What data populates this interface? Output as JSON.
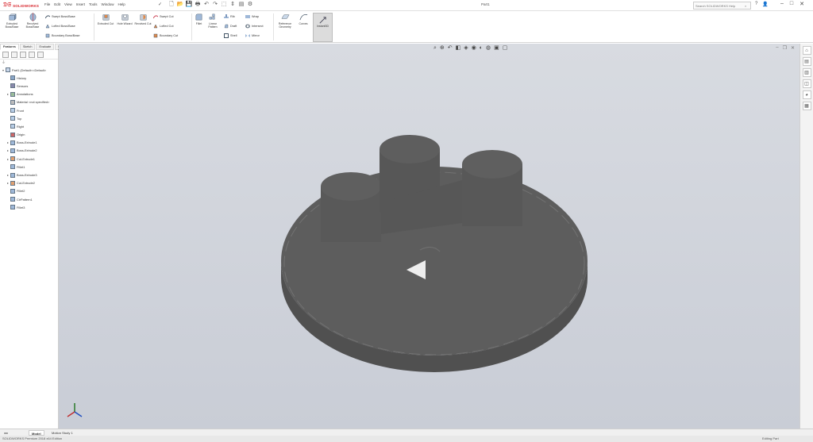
{
  "app": {
    "brand": "SOLIDWORKS",
    "doc_title": "Part1"
  },
  "menu": [
    "File",
    "Edit",
    "View",
    "Insert",
    "Tools",
    "Window",
    "Help"
  ],
  "quick_access_icons": [
    "new-doc-icon",
    "open-icon",
    "save-icon",
    "print-icon",
    "undo-icon",
    "redo-icon",
    "select-icon",
    "rebuild-icon",
    "file-props-icon",
    "options-icon"
  ],
  "search": {
    "placeholder": "Search SOLIDWORKS Help"
  },
  "ribbon": {
    "extruded_bossbase": "Extruded Boss/Base",
    "revolved_bossbase": "Revolved Boss/Base",
    "swept_bossbase": "Swept Boss/Base",
    "lofted_bossbase": "Lofted Boss/Base",
    "boundary_bossbase": "Boundary Boss/Base",
    "extruded_cut": "Extruded Cut",
    "hole_wizard": "Hole Wizard",
    "revolved_cut": "Revolved Cut",
    "swept_cut": "Swept Cut",
    "lofted_cut": "Lofted Cut",
    "boundary_cut": "Boundary Cut",
    "fillet": "Fillet",
    "linear_pattern": "Linear Pattern",
    "rib": "Rib",
    "draft": "Draft",
    "shell": "Shell",
    "wrap": "Wrap",
    "intersect": "Intersect",
    "mirror": "Mirror",
    "reference_geometry": "Reference Geometry",
    "curves": "Curves",
    "instant3d": "Instant3D"
  },
  "command_tabs": [
    "Features",
    "Sketch",
    "Evaluate",
    "MBD Dimensions"
  ],
  "feature_tree": {
    "root": "Part1 (Default<<Default>",
    "items": [
      {
        "label": "History",
        "icon": "history-icon",
        "level": 1
      },
      {
        "label": "Sensors",
        "icon": "sensor-icon",
        "level": 1
      },
      {
        "label": "Annotations",
        "icon": "annotation-icon",
        "level": 1,
        "expandable": true
      },
      {
        "label": "Material <not specified>",
        "icon": "material-icon",
        "level": 1
      },
      {
        "label": "Front",
        "icon": "plane-icon",
        "level": 1
      },
      {
        "label": "Top",
        "icon": "plane-icon",
        "level": 1
      },
      {
        "label": "Right",
        "icon": "plane-icon",
        "level": 1
      },
      {
        "label": "Origin",
        "icon": "origin-icon",
        "level": 1
      },
      {
        "label": "Boss-Extrude1",
        "icon": "extrude-icon",
        "level": 1,
        "expandable": true
      },
      {
        "label": "Boss-Extrude2",
        "icon": "extrude-icon",
        "level": 1,
        "expandable": true
      },
      {
        "label": "Cut-Extrude1",
        "icon": "cut-icon",
        "level": 1,
        "expandable": true
      },
      {
        "label": "Fillet1",
        "icon": "fillet-icon",
        "level": 1
      },
      {
        "label": "Boss-Extrude3",
        "icon": "extrude-icon",
        "level": 1,
        "expandable": true
      },
      {
        "label": "Cut-Extrude2",
        "icon": "cut-icon",
        "level": 1,
        "expandable": true
      },
      {
        "label": "Fillet2",
        "icon": "fillet-icon",
        "level": 1
      },
      {
        "label": "CirPattern1",
        "icon": "pattern-icon",
        "level": 1
      },
      {
        "label": "Fillet3",
        "icon": "fillet-icon",
        "level": 1
      }
    ]
  },
  "bottom_tabs": [
    "Model",
    "Motion Study 1"
  ],
  "status": {
    "left": "SOLIDWORKS Premium 2018 x64 Edition",
    "right": "Editing Part"
  },
  "colors": {
    "viewport_top": "#d8dbe1",
    "viewport_bottom": "#c9cdd6",
    "model": "#5c5c5c",
    "brand": "#d8282f"
  }
}
